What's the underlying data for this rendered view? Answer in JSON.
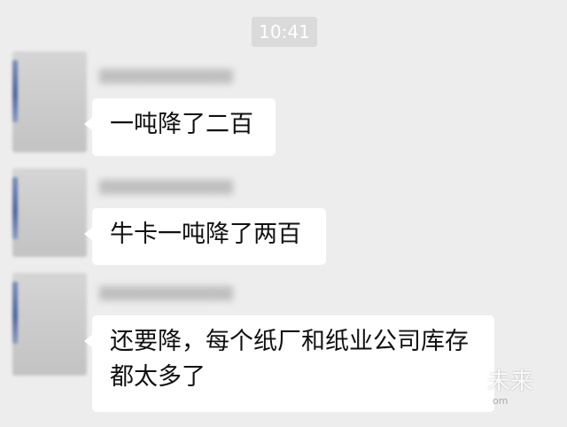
{
  "chat": {
    "timestamp": "10:41",
    "messages": [
      {
        "text": "一吨降了二百"
      },
      {
        "text": "牛卡一吨降了两百"
      },
      {
        "text": "还要降，每个纸厂和纸业公司库存\n都太多了"
      }
    ]
  },
  "watermark": {
    "text": "未来",
    "subtext": "om"
  }
}
